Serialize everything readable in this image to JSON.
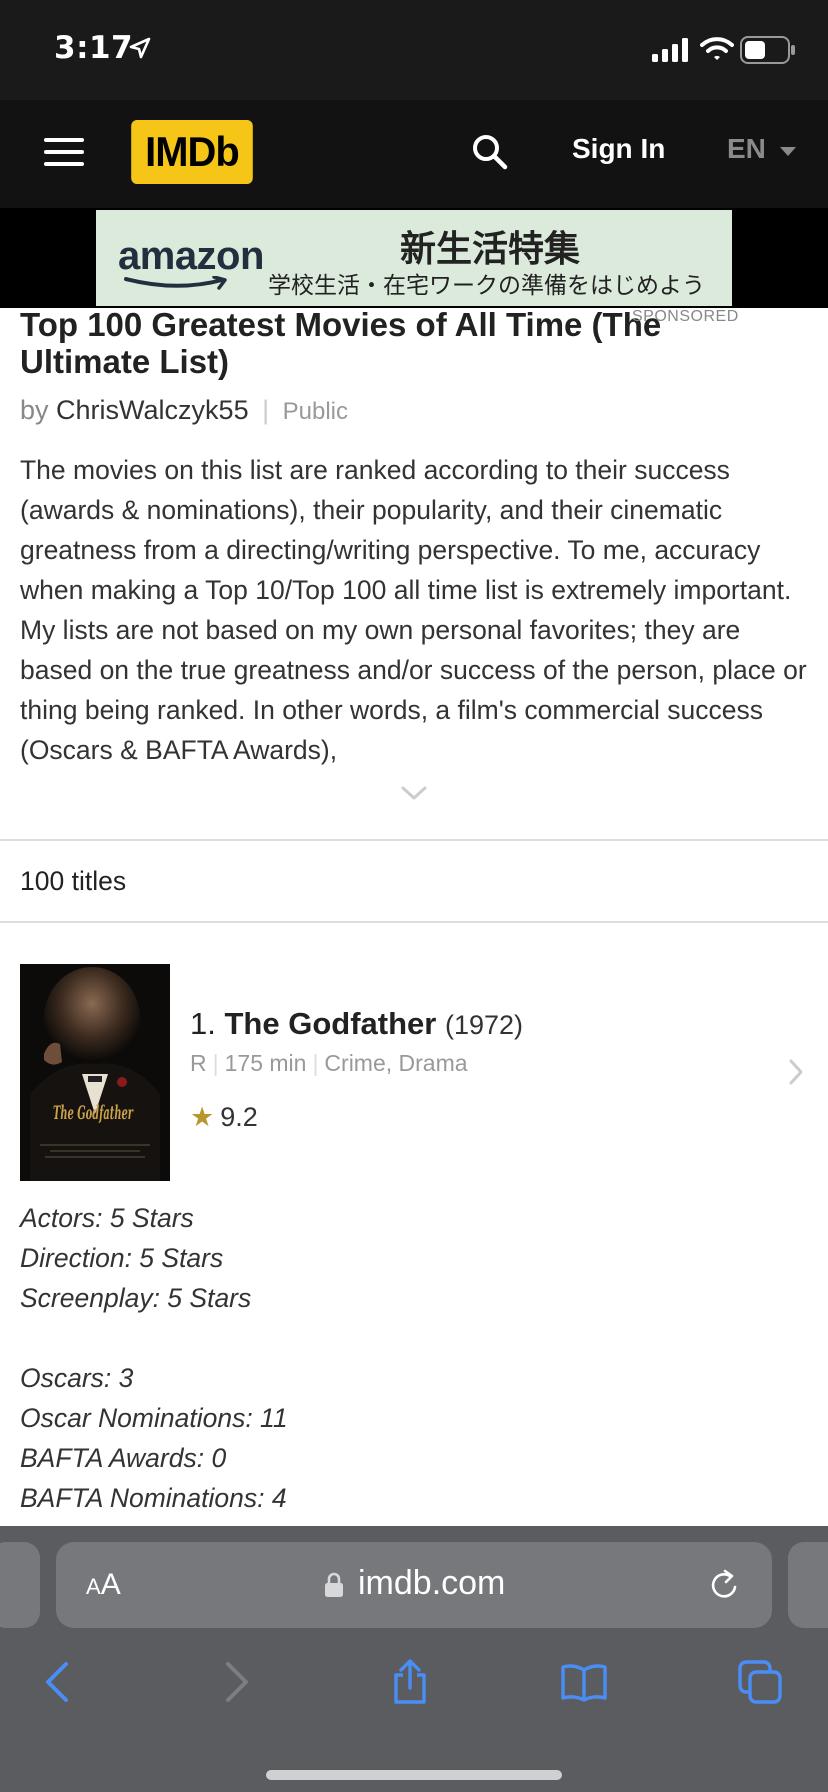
{
  "status_bar": {
    "time": "3:17"
  },
  "header": {
    "logo": "IMDb",
    "sign_in": "Sign In",
    "language": "EN"
  },
  "ad": {
    "brand": "amazon",
    "headline": "新生活特集",
    "subline": "学校生活・在宅ワークの準備をはじめよう",
    "sponsored_label": "SPONSORED",
    "background_color": "#dceadb"
  },
  "list": {
    "title": "Top 100 Greatest Movies of All Time (The Ultimate List)",
    "by_label": "by",
    "author": "ChrisWalczyk55",
    "visibility": "Public",
    "description": "The movies on this list are ranked according to their success (awards & nominations), their popularity, and their cinematic greatness from a directing/writing perspective. To me, accuracy when making a Top 10/Top 100 all time list is extremely important. My lists are not based on my own personal favorites; they are based on the true greatness and/or success of the person, place or thing being ranked. In other words, a film's commercial success (Oscars & BAFTA Awards),",
    "count": "100 titles"
  },
  "items": [
    {
      "rank": "1.",
      "title": "The Godfather",
      "year": "(1972)",
      "certificate": "R",
      "runtime": "175 min",
      "genres": "Crime, Drama",
      "rating": "9.2",
      "poster_text": "The Godfather",
      "notes": {
        "actors": "Actors: 5 Stars",
        "direction": "Direction: 5 Stars",
        "screenplay": "Screenplay: 5 Stars",
        "oscars": "Oscars: 3",
        "oscar_nominations": "Oscar Nominations: 11",
        "bafta_awards": "BAFTA Awards: 0",
        "bafta_nominations": "BAFTA Nominations: 4"
      }
    }
  ],
  "browser": {
    "aa_large": "A",
    "aa_small": "A",
    "url": "imdb.com"
  },
  "colors": {
    "imdb_yellow": "#f5c518",
    "header_bg": "#121212",
    "star": "#b8962e",
    "safari_blue": "#4a8ef5"
  }
}
